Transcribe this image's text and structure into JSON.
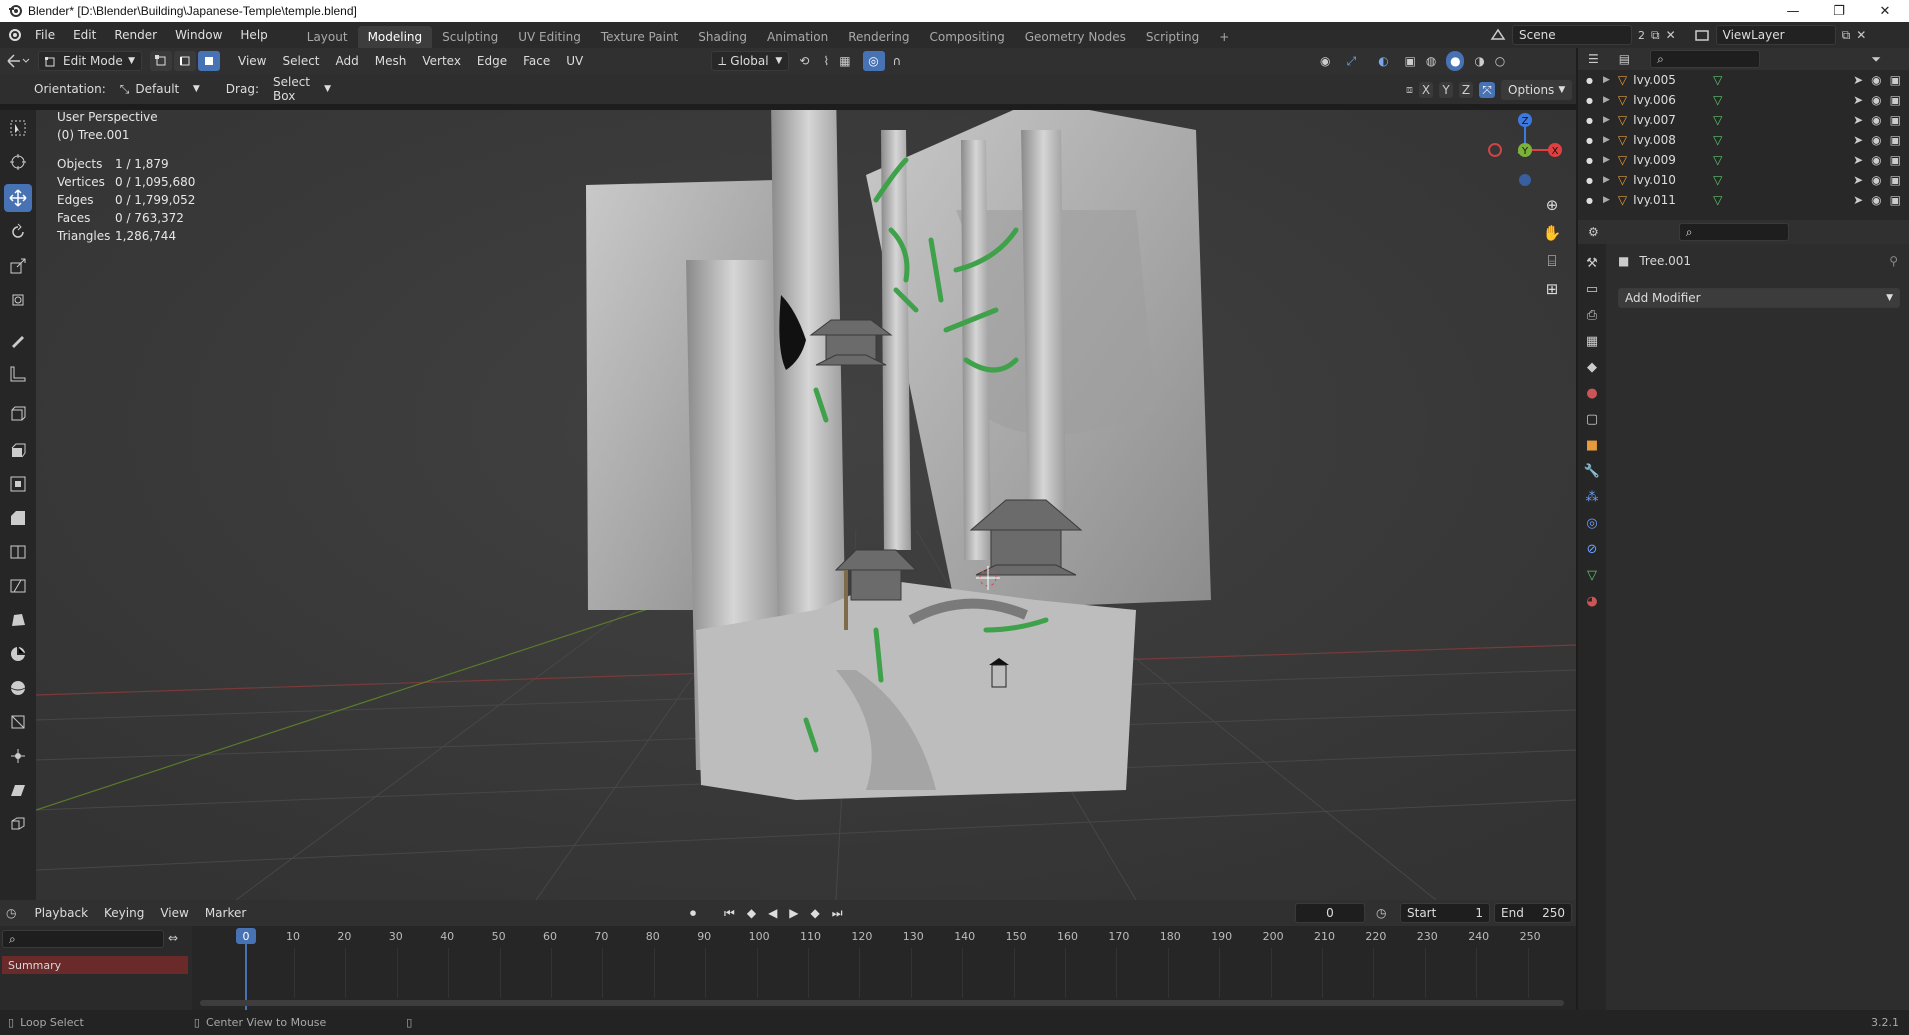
{
  "window": {
    "title": "Blender* [D:\\Blender\\Building\\Japanese-Temple\\temple.blend]",
    "controls": [
      "—",
      "❐",
      "✕"
    ]
  },
  "menu": [
    "File",
    "Edit",
    "Render",
    "Window",
    "Help"
  ],
  "workspaces": {
    "tabs": [
      "Layout",
      "Modeling",
      "Sculpting",
      "UV Editing",
      "Texture Paint",
      "Shading",
      "Animation",
      "Rendering",
      "Compositing",
      "Geometry Nodes",
      "Scripting"
    ],
    "active": "Modeling",
    "add_label": "+"
  },
  "scene": {
    "label": "Scene",
    "count": "2",
    "viewlayer": "ViewLayer"
  },
  "viewport_header": {
    "mode": "Edit Mode",
    "menus": [
      "View",
      "Select",
      "Add",
      "Mesh",
      "Vertex",
      "Edge",
      "Face",
      "UV"
    ],
    "transform_orientation": "Global",
    "options_label": "Options",
    "axes": [
      "X",
      "Y",
      "Z"
    ]
  },
  "tool_header": {
    "orientation_label": "Orientation:",
    "orientation_value": "Default",
    "drag_label": "Drag:",
    "drag_value": "Select Box"
  },
  "viewport_info": {
    "perspective": "User Perspective",
    "object": "(0) Tree.001",
    "stats": [
      {
        "label": "Objects",
        "value": "1 / 1,879"
      },
      {
        "label": "Vertices",
        "value": "0 / 1,095,680"
      },
      {
        "label": "Edges",
        "value": "0 / 1,799,052"
      },
      {
        "label": "Faces",
        "value": "0 / 763,372"
      },
      {
        "label": "Triangles",
        "value": "1,286,744"
      }
    ]
  },
  "gizmo": {
    "z": "Z",
    "x": "X",
    "y": "Y"
  },
  "outliner": {
    "items": [
      "Ivy.005",
      "Ivy.006",
      "Ivy.007",
      "Ivy.008",
      "Ivy.009",
      "Ivy.010",
      "Ivy.011"
    ]
  },
  "properties": {
    "object_name": "Tree.001",
    "add_modifier": "Add Modifier"
  },
  "timeline": {
    "menus": [
      "Playback",
      "Keying",
      "View",
      "Marker"
    ],
    "current_frame": "0",
    "start_label": "Start",
    "start_value": "1",
    "end_label": "End",
    "end_value": "250",
    "playhead": "0",
    "ticks": [
      "10",
      "20",
      "30",
      "40",
      "50",
      "60",
      "70",
      "80",
      "90",
      "100",
      "110",
      "120",
      "130",
      "140",
      "150",
      "160",
      "170",
      "180",
      "190",
      "200",
      "210",
      "220",
      "230",
      "240",
      "250"
    ],
    "summary": "Summary"
  },
  "statusbar": {
    "left": "Loop Select",
    "middle": "Center View to Mouse",
    "version": "3.2.1"
  },
  "colors": {
    "accent": "#4772b3",
    "ivy_green": "#3fa14a",
    "summary_bg": "#6b2a2a"
  }
}
